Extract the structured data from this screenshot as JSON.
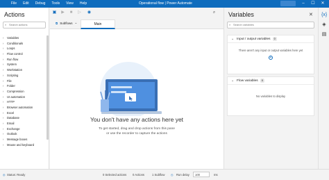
{
  "titlebar": {
    "menus": [
      "File",
      "Edit",
      "Debug",
      "Tools",
      "View",
      "Help"
    ],
    "title": "Operational flow | Power Automate"
  },
  "actions_panel": {
    "title": "Actions",
    "search_placeholder": "Search actions",
    "items": [
      "Variables",
      "Conditionals",
      "Loops",
      "Flow control",
      "Run flow",
      "System",
      "Workstation",
      "Scripting",
      "File",
      "Folder",
      "Compression",
      "UI automation",
      "HTTP",
      "Browser automation",
      "Excel",
      "Database",
      "Email",
      "Exchange",
      "Outlook",
      "Message boxes",
      "Mouse and keyboard"
    ]
  },
  "tabs": {
    "subflows_label": "Subflows",
    "main_label": "Main"
  },
  "canvas": {
    "empty_title": "You don't have any actions here yet",
    "empty_line1": "To get started, drag and drop actions from this pane",
    "empty_line2": "or use the recorder to capture the actions"
  },
  "variables_panel": {
    "title": "Variables",
    "search_placeholder": "Search variables",
    "io_section": {
      "label": "Input / output variables",
      "count": "0",
      "message": "There aren't any input or output variables here yet"
    },
    "flow_section": {
      "label": "Flow variables",
      "count": "0",
      "message": "No variables to display"
    }
  },
  "statusbar": {
    "status": "Status: Ready",
    "selected_actions": "0 Selected actions",
    "actions": "0 Actions",
    "subflows": "1 Subflow",
    "run_delay_label": "Run delay",
    "run_delay_value": "100",
    "unit": "ms"
  },
  "colors": {
    "accent": "#0f6cbd",
    "titlebar": "#0f6cbd",
    "panel_bg": "#f3f3f3"
  }
}
